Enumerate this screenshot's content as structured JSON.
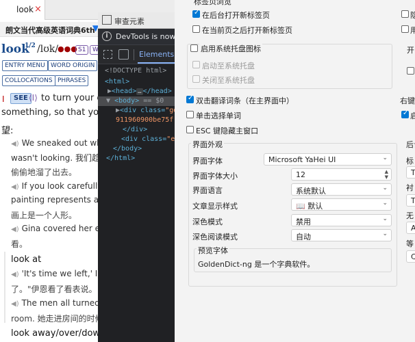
{
  "tab": {
    "label": "look",
    "add_icon": "+",
    "close_icon": "×"
  },
  "dict_bar": {
    "title": "朗文当代高级英语词典6th",
    "chevron": "▼"
  },
  "entry": {
    "headword": "look",
    "superscript": "1/2",
    "pronunciation": "/lʊk/",
    "frequency_dots": "●●●",
    "tags": [
      "S1",
      "W"
    ],
    "buttons": [
      "ENTRY MENU",
      "WORD ORIGIN",
      "COLLOCATIONS",
      "PHRASES"
    ],
    "sense_marker": "I",
    "see_label": "SEE",
    "see_tag": "⟨I⟩",
    "def_line1": "to turn your ey",
    "def_line2": "something, so that you ca",
    "def_line3": "望:",
    "examples": [
      {
        "en1": "We sneaked out whil",
        "en2": "wasn't looking. 我们趁",
        "zh": "偷偷地溜了出去。"
      },
      {
        "en1": "If you look carefully y",
        "en2": "painting represents a hu",
        "zh": "画上是一个人形。"
      },
      {
        "en1": "Gina covered her eye",
        "zh": "看。"
      }
    ],
    "phrase1": "look at",
    "phrase1_examples": [
      {
        "en1": "'It's time we left,' Ian",
        "zh": "了。\"伊恩看了看表说。"
      },
      {
        "en1": "The men all turned to",
        "zh": "room. 她走进房间的时候"
      }
    ],
    "phrase2": "look away/over/down"
  },
  "devtools": {
    "title": "审查元素",
    "info": "DevTools is now ava",
    "info_icon": "i",
    "tab": "Elements",
    "lines": {
      "l1": "<!DOCTYPE html>",
      "l2": "<html>",
      "l3_tag": "<head>",
      "l3_end": "</head>",
      "l4_tag": "<body>",
      "l4_eq": "== $0",
      "l5_pre": "<div class=",
      "l5_val": "\"gd",
      "l6_val": "911960900be75f",
      "l7": "</div>",
      "l8_pre": "<div class=",
      "l8_val": "\"em",
      "l9": "</body>",
      "l10": "</html>"
    },
    "ellipsis": "…"
  },
  "settings": {
    "tab_behavior_group": "标签页浏览",
    "opt_new_tab_bg": "在后台打开新标签页",
    "opt_new_tab_after": "在当前页之后打开新标签页",
    "right_cut1": "隐",
    "right_cut2": "用",
    "tray_label": "启用系统托盘图标",
    "tray_start": "启动至系统托盘",
    "tray_close": "关闭至系统托盘",
    "right_cut3": "开",
    "dbl_click": "双击翻译词条（在主界面中）",
    "single_click": "单击选择单词",
    "esc_hide": "ESC 键隐藏主窗口",
    "right_cut4": "右键",
    "right_cut5": "启",
    "appearance_group": "界面外观",
    "font_label": "界面字体",
    "font_value": "Microsoft YaHei UI",
    "font_size_label": "界面字体大小",
    "font_size_value": "12",
    "lang_label": "界面语言",
    "lang_value": "系统默认",
    "style_label": "文章显示样式",
    "style_value": "默认",
    "style_icon": "📖",
    "dark_label": "深色模式",
    "dark_value": "禁用",
    "dark_read_label": "深色阅读模式",
    "dark_read_value": "自动",
    "preview_group": "预览字体",
    "preview_text": "GoldenDict-ng 是一个字典软件。",
    "right_col": [
      "后台",
      "标",
      "Ti",
      "衬",
      "Ti",
      "无",
      "A",
      "等",
      "Co"
    ],
    "combo_arrow": "⌄",
    "spin_up": "▲",
    "spin_down": "▼"
  }
}
